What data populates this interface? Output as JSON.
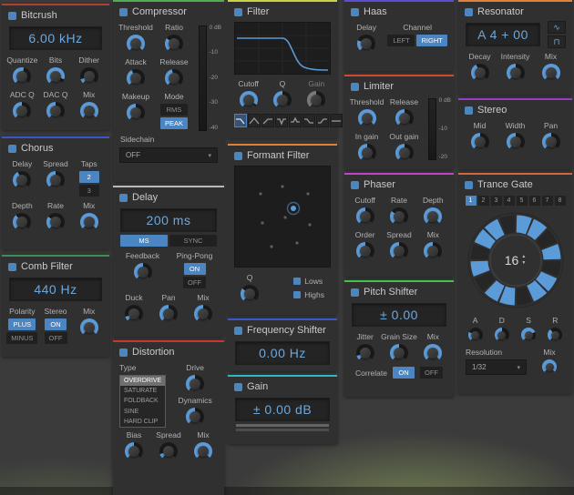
{
  "colors": {
    "accent": "#5b9bd8",
    "display_text": "#6fa7da"
  },
  "icons": {
    "chevron_down": "▾",
    "sine": "∿",
    "pulse": "⊓",
    "spin_up": "▲",
    "spin_down": "▼"
  },
  "panel_colors": {
    "bitcrush": "#b04030",
    "chorus": "#3a57c9",
    "comb": "#3d8f57",
    "compressor": "#4fae4f",
    "delay": "#b9b9b9",
    "distortion": "#c3392f",
    "filter": "#c9d144",
    "formant": "#e0813a",
    "freq_shifter": "#3a57c9",
    "gain": "#2fb7c5",
    "haas": "#5b4fd0",
    "limiter": "#d04a32",
    "phaser": "#c243c9",
    "pitch": "#46c24a",
    "resonator": "#e0813a",
    "stereo": "#9a3ac9",
    "trance_gate": "#d0663a"
  },
  "panels": {
    "bitcrush": {
      "title": "Bitcrush",
      "display": "6.00 kHz",
      "labels": {
        "quantize": "Quantize",
        "bits": "Bits",
        "dither": "Dither",
        "adcq": "ADC Q",
        "dacq": "DAC Q",
        "mix": "Mix"
      },
      "knobs": {
        "quantize": 0.55,
        "bits": 0.9,
        "dither": 0.1,
        "adcq": 0.5,
        "dacq": 0.5,
        "mix": 1
      }
    },
    "chorus": {
      "title": "Chorus",
      "labels": {
        "delay": "Delay",
        "spread": "Spread",
        "taps": "Taps",
        "depth": "Depth",
        "rate": "Rate",
        "mix": "Mix"
      },
      "taps": {
        "options": [
          "2",
          "3"
        ],
        "selected": "2"
      },
      "knobs": {
        "delay": 0.4,
        "spread": 0.5,
        "depth": 0.35,
        "rate": 0.3,
        "mix": 1
      }
    },
    "comb": {
      "title": "Comb Filter",
      "display": "440 Hz",
      "labels": {
        "polarity": "Polarity",
        "stereo": "Stereo",
        "mix": "Mix"
      },
      "polarity": {
        "options": [
          "PLUS",
          "MINUS"
        ],
        "selected": "PLUS"
      },
      "stereo": {
        "options": [
          "ON",
          "OFF"
        ],
        "selected": "ON"
      },
      "knobs": {
        "mix": 1
      }
    },
    "compressor": {
      "title": "Compressor",
      "labels": {
        "threshold": "Threshold",
        "ratio": "Ratio",
        "attack": "Attack",
        "release": "Release",
        "makeup": "Makeup",
        "mode": "Mode",
        "sidechain": "Sidechain"
      },
      "meter_scale": [
        "0 dB",
        "-10",
        "-20",
        "-30",
        "-40"
      ],
      "mode": {
        "options": [
          "RMS",
          "PEAK"
        ],
        "selected": "PEAK"
      },
      "sidechain_value": "OFF",
      "knobs": {
        "threshold": 1,
        "ratio": 0.3,
        "attack": 0.4,
        "release": 0.45,
        "makeup": 0.5
      }
    },
    "delay": {
      "title": "Delay",
      "display": "200 ms",
      "time_mode": {
        "options": [
          "MS",
          "SYNC"
        ],
        "selected": "MS"
      },
      "labels": {
        "feedback": "Feedback",
        "pingpong": "Ping-Pong",
        "duck": "Duck",
        "pan": "Pan",
        "mix": "Mix"
      },
      "pingpong": {
        "options": [
          "ON",
          "OFF"
        ],
        "selected": "ON"
      },
      "knobs": {
        "feedback": 0.5,
        "duck": 0.1,
        "pan": 0.5,
        "mix": 0.5
      }
    },
    "distortion": {
      "title": "Distortion",
      "labels": {
        "type": "Type",
        "drive": "Drive",
        "dynamics": "Dynamics",
        "bias": "Bias",
        "spread": "Spread",
        "mix": "Mix"
      },
      "types": [
        "OVERDRIVE",
        "SATURATE",
        "FOLDBACK",
        "SINE",
        "HARD CLIP"
      ],
      "selected_type": "OVERDRIVE",
      "knobs": {
        "drive": 0.5,
        "dynamics": 0.5,
        "bias": 0.5,
        "spread": 0.1,
        "mix": 1
      }
    },
    "filter": {
      "title": "Filter",
      "labels": {
        "cutoff": "Cutoff",
        "q": "Q",
        "gain": "Gain"
      },
      "shapes": [
        "low-pass",
        "band-pass",
        "high-pass",
        "notch",
        "peak",
        "low-shelf",
        "high-shelf",
        "all-pass"
      ],
      "selected_shape": "low-pass",
      "knobs": {
        "cutoff": 0.95,
        "q": 0.5,
        "gain": 0.5
      }
    },
    "formant": {
      "title": "Formant Filter",
      "labels": {
        "q": "Q",
        "lows": "Lows",
        "highs": "Highs"
      },
      "checkboxes": {
        "lows": true,
        "highs": true
      },
      "knobs": {
        "q": 0.3
      }
    },
    "freq_shifter": {
      "title": "Frequency Shifter",
      "display": "0.00 Hz"
    },
    "gain": {
      "title": "Gain",
      "display": "± 0.00 dB"
    },
    "haas": {
      "title": "Haas",
      "labels": {
        "delay": "Delay",
        "channel": "Channel"
      },
      "channel": {
        "options": [
          "LEFT",
          "RIGHT"
        ],
        "selected": "RIGHT"
      },
      "knobs": {
        "delay": 0.25
      }
    },
    "limiter": {
      "title": "Limiter",
      "labels": {
        "threshold": "Threshold",
        "release": "Release",
        "in_gain": "In gain",
        "out_gain": "Out gain"
      },
      "meter_scale": [
        "0 dB",
        "-10",
        "-20"
      ],
      "knobs": {
        "threshold": 1,
        "release": 0.5,
        "in_gain": 0.5,
        "out_gain": 0.5
      }
    },
    "phaser": {
      "title": "Phaser",
      "labels": {
        "cutoff": "Cutoff",
        "rate": "Rate",
        "depth": "Depth",
        "order": "Order",
        "spread": "Spread",
        "mix": "Mix"
      },
      "knobs": {
        "cutoff": 0.5,
        "rate": 0.3,
        "depth": 1,
        "order": 0.5,
        "spread": 0.5,
        "mix": 0.5
      }
    },
    "pitch": {
      "title": "Pitch Shifter",
      "display": "± 0.00",
      "labels": {
        "jitter": "Jitter",
        "grain": "Grain Size",
        "mix": "Mix",
        "correlate": "Correlate"
      },
      "correlate": {
        "options": [
          "ON",
          "OFF"
        ],
        "selected": "ON"
      },
      "knobs": {
        "jitter": 0.1,
        "grain": 0.5,
        "mix": 1
      }
    },
    "resonator": {
      "title": "Resonator",
      "display": "A 4 + 00",
      "labels": {
        "decay": "Decay",
        "intensity": "Intensity",
        "mix": "Mix"
      },
      "knobs": {
        "decay": 0.4,
        "intensity": 0.5,
        "mix": 1
      }
    },
    "stereo": {
      "title": "Stereo",
      "labels": {
        "mid": "Mid",
        "width": "Width",
        "pan": "Pan"
      },
      "knobs": {
        "mid": 0.5,
        "width": 0.5,
        "pan": 0.5
      }
    },
    "trance_gate": {
      "title": "Trance Gate",
      "steps": [
        "1",
        "2",
        "3",
        "4",
        "5",
        "6",
        "7",
        "8"
      ],
      "selected_step": "1",
      "pattern": [
        1,
        1,
        0,
        1,
        0,
        1,
        1,
        0,
        1,
        1,
        0,
        1,
        0,
        1,
        1,
        0
      ],
      "center_value": "16",
      "labels": {
        "a": "A",
        "d": "D",
        "s": "S",
        "r": "R",
        "resolution": "Resolution",
        "mix": "Mix"
      },
      "resolution_value": "1/32",
      "knobs": {
        "a": 0.25,
        "d": 0.5,
        "s": 0.75,
        "r": 0.35,
        "mix": 1
      }
    }
  }
}
